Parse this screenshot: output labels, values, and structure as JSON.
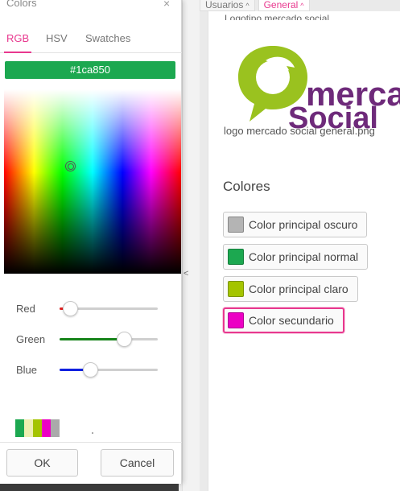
{
  "dialog": {
    "title": "Colors",
    "close_glyph": "×",
    "tabs": [
      "RGB",
      "HSV",
      "Swatches"
    ],
    "active_tab": "RGB",
    "hex_value": "#1ca850",
    "current_color": "#1ca850",
    "sliders": [
      {
        "label": "Red",
        "value": 28,
        "max": 255,
        "color": "#e02020"
      },
      {
        "label": "Green",
        "value": 168,
        "max": 255,
        "color": "#17841a"
      },
      {
        "label": "Blue",
        "value": 80,
        "max": 255,
        "color": "#1020e0"
      }
    ],
    "recent_colors": [
      "#1ca850",
      "#eeeeb0",
      "#a4c400",
      "#ec00c4",
      "#aaaaaa"
    ],
    "ok_label": "OK",
    "cancel_label": "Cancel",
    "accent": "#e8388e"
  },
  "tabs": [
    {
      "label": "Usuarios",
      "caret": "^"
    },
    {
      "label": "General",
      "caret": "^"
    }
  ],
  "active_tab": "General",
  "splitter_arrow": "<",
  "content": {
    "logo_label_cut": "Logotipo mercado social",
    "logo_text": {
      "line1": "mercad",
      "line2": "Social"
    },
    "logo_caption": "logo mercado social general.png",
    "section_title": "Colores",
    "color_buttons": [
      {
        "label": "Color principal oscuro",
        "swatch": "#b4b4b4"
      },
      {
        "label": "Color principal normal",
        "swatch": "#1ca850"
      },
      {
        "label": "Color principal claro",
        "swatch": "#a4c400"
      },
      {
        "label": "Color secundario",
        "swatch": "#ec00c4",
        "focused": true
      }
    ]
  }
}
